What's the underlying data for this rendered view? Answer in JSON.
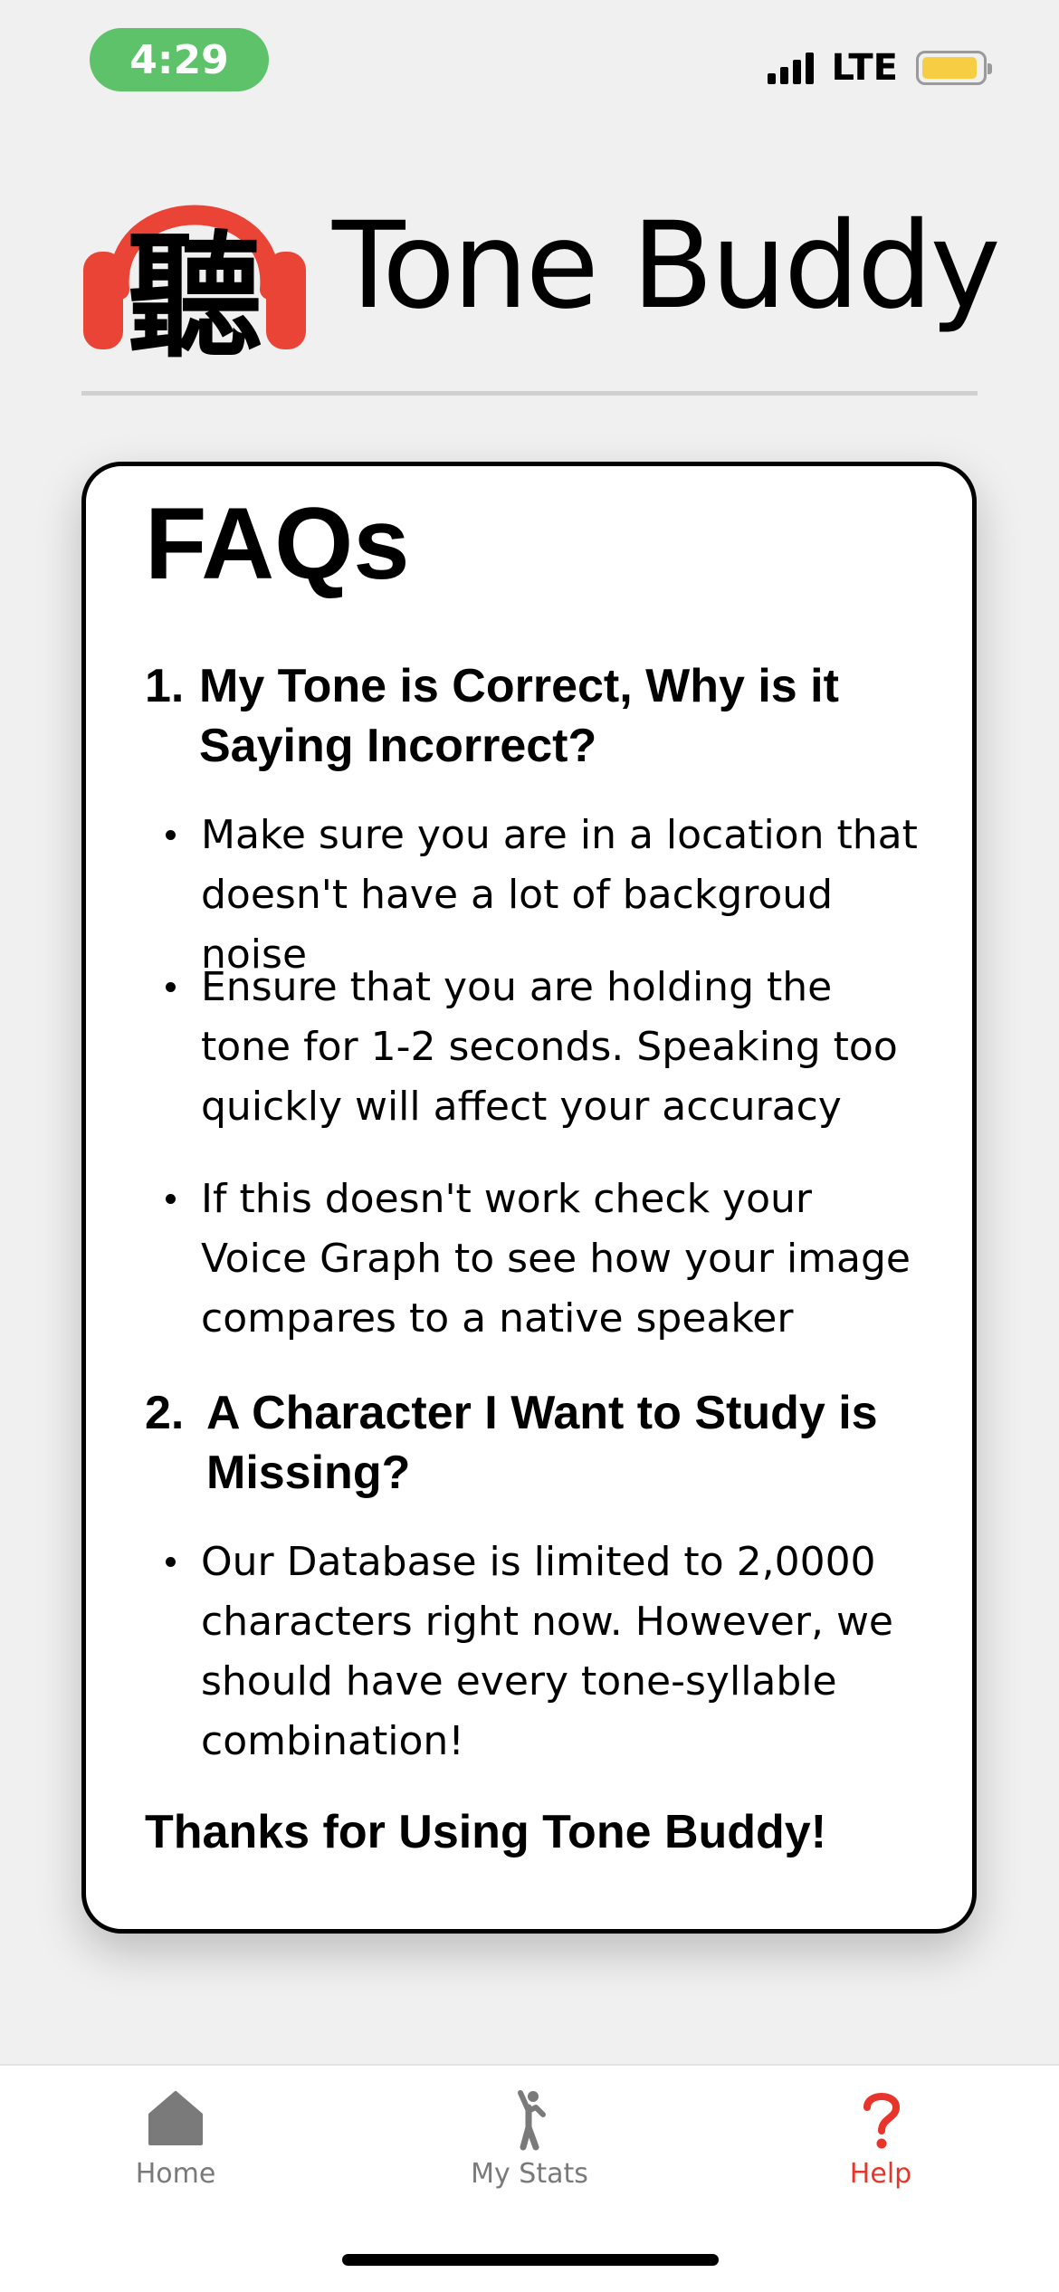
{
  "status_bar": {
    "time": "4:29",
    "network": "LTE"
  },
  "header": {
    "logo_character": "聽",
    "title": "Tone Buddy"
  },
  "faq": {
    "title": "FAQs",
    "questions": [
      {
        "number": "1.",
        "question": "My Tone is Correct, Why is it Saying Incorrect?",
        "answers": [
          "Make sure you are in a location that doesn't have a lot of backgroud noise",
          "Ensure that you are holding the tone for 1-2 seconds. Speaking too quickly will affect your accuracy",
          "If this doesn't work check your Voice Graph to see how your image compares to a native speaker"
        ]
      },
      {
        "number": "2.",
        "question": "A Character I Want to Study is Missing?",
        "answers": [
          "Our Database is limited to 2,0000 characters right now. However, we should have every tone-syllable combination!"
        ]
      }
    ],
    "closing": "Thanks for Using Tone Buddy!"
  },
  "tabs": [
    {
      "label": "Home",
      "icon": "home-icon",
      "active": false
    },
    {
      "label": "My Stats",
      "icon": "person-stats-icon",
      "active": false
    },
    {
      "label": "Help",
      "icon": "question-mark-icon",
      "active": true
    }
  ],
  "colors": {
    "accent": "#e8352b",
    "logo_red": "#ea4436",
    "time_pill": "#5ec26a",
    "battery": "#f7cd43"
  }
}
